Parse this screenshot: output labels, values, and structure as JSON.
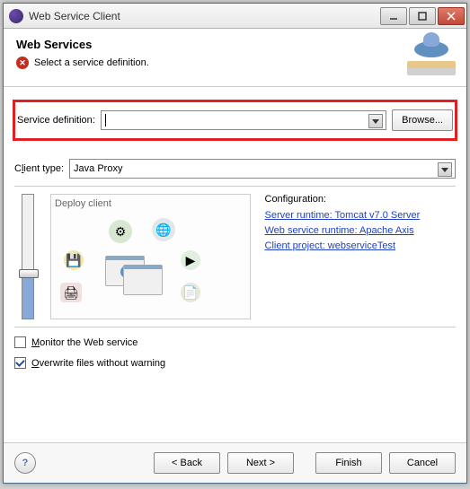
{
  "window": {
    "title": "Web Service Client"
  },
  "header": {
    "title": "Web Services",
    "message": "Select a service definition."
  },
  "form": {
    "service_def_label": "Service definition:",
    "service_def_value": "",
    "browse_label": "Browse...",
    "client_type_label": "Client type:",
    "client_type_value": "Java Proxy"
  },
  "diagram": {
    "title": "Deploy client"
  },
  "config": {
    "title": "Configuration:",
    "links": {
      "runtime": "Server runtime: Tomcat v7.0 Server",
      "ws_runtime": "Web service runtime: Apache Axis",
      "project": "Client project: webserviceTest"
    }
  },
  "options": {
    "monitor": "onitor the Web service",
    "monitor_accel": "M",
    "overwrite": "verwrite files without warning",
    "overwrite_accel": "O"
  },
  "buttons": {
    "help": "?",
    "back": "< Back",
    "next": "Next >",
    "finish": "Finish",
    "cancel": "Cancel"
  }
}
